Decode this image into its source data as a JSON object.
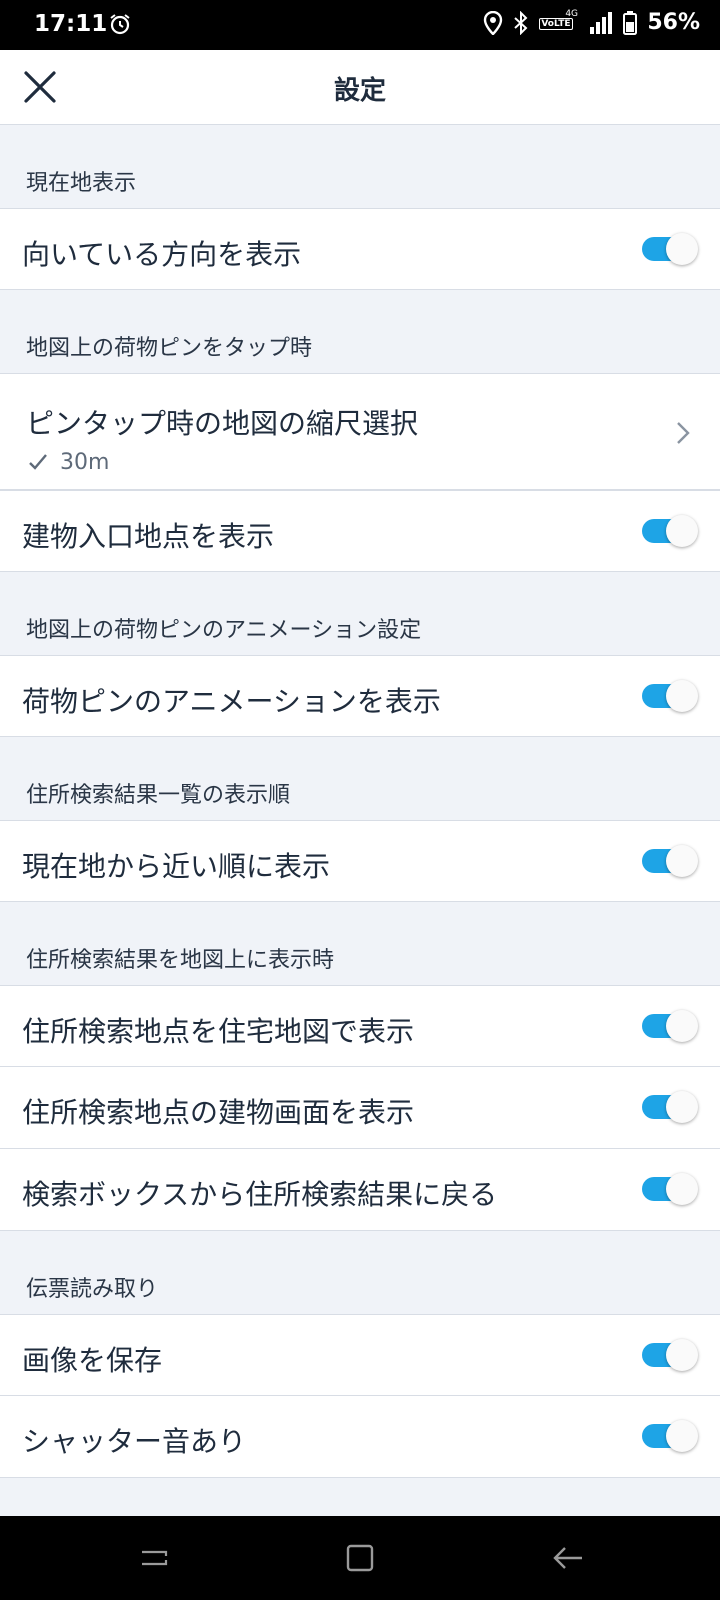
{
  "status": {
    "time": "17:11",
    "battery": "56%",
    "net_label": "VoLTE",
    "net_type": "4G"
  },
  "header": {
    "title": "設定"
  },
  "sections": [
    {
      "title": "現在地表示",
      "items": [
        {
          "label": "向いている方向を表示",
          "toggle": true
        }
      ]
    },
    {
      "title": "地図上の荷物ピンをタップ時",
      "items": [
        {
          "label": "ピンタップ時の地図の縮尺選択",
          "value": "30m"
        },
        {
          "label": "建物入口地点を表示",
          "toggle": true
        }
      ]
    },
    {
      "title": "地図上の荷物ピンのアニメーション設定",
      "items": [
        {
          "label": "荷物ピンのアニメーションを表示",
          "toggle": true
        }
      ]
    },
    {
      "title": "住所検索結果一覧の表示順",
      "items": [
        {
          "label": "現在地から近い順に表示",
          "toggle": true
        }
      ]
    },
    {
      "title": "住所検索結果を地図上に表示時",
      "items": [
        {
          "label": "住所検索地点を住宅地図で表示",
          "toggle": true
        },
        {
          "label": "住所検索地点の建物画面を表示",
          "toggle": true
        },
        {
          "label": "検索ボックスから住所検索結果に戻る",
          "toggle": true
        }
      ]
    },
    {
      "title": "伝票読み取り",
      "items": [
        {
          "label": "画像を保存",
          "toggle": true
        },
        {
          "label": "シャッター音あり",
          "toggle": true
        }
      ]
    }
  ],
  "colors": {
    "accent": "#1ea4e6",
    "background": "#f0f3f8",
    "text": "#1f2c3d"
  },
  "icons": {
    "close": "close-icon",
    "chevron": "chevron-right-icon",
    "check": "check-icon"
  }
}
